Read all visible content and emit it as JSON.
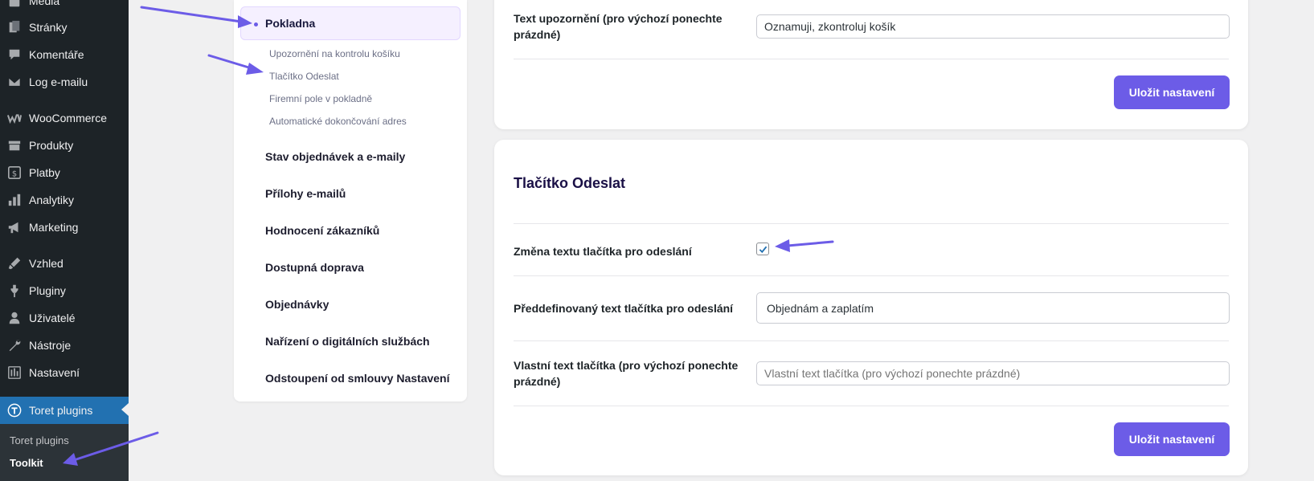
{
  "wp_menu": {
    "items": [
      {
        "label": "Média",
        "icon": "media-icon"
      },
      {
        "label": "Stránky",
        "icon": "pages-icon"
      },
      {
        "label": "Komentáře",
        "icon": "comments-icon"
      },
      {
        "label": "Log e-mailu",
        "icon": "email-icon"
      },
      {
        "label": "WooCommerce",
        "icon": "woocommerce-icon"
      },
      {
        "label": "Produkty",
        "icon": "products-icon"
      },
      {
        "label": "Platby",
        "icon": "payments-icon"
      },
      {
        "label": "Analytiky",
        "icon": "analytics-icon"
      },
      {
        "label": "Marketing",
        "icon": "marketing-icon"
      },
      {
        "label": "Vzhled",
        "icon": "appearance-icon"
      },
      {
        "label": "Pluginy",
        "icon": "plugins-icon"
      },
      {
        "label": "Uživatelé",
        "icon": "users-icon"
      },
      {
        "label": "Nástroje",
        "icon": "tools-icon"
      },
      {
        "label": "Nastavení",
        "icon": "settings-icon"
      },
      {
        "label": "Toret plugins",
        "icon": "toret-icon"
      }
    ],
    "submenu": [
      "Toret plugins",
      "Toolkit"
    ]
  },
  "settings_nav": {
    "current": "Pokladna",
    "subitems": [
      "Upozornění na kontrolu košíku",
      "Tlačítko Odeslat",
      "Firemní pole v pokladně",
      "Automatické dokončování adres"
    ],
    "items": [
      "Stav objednávek a e-maily",
      "Přílohy e-mailů",
      "Hodnocení zákazníků",
      "Dostupná doprava",
      "Objednávky",
      "Nařízení o digitálních službách",
      "Odstoupení od smlouvy Nastavení"
    ]
  },
  "card1": {
    "warning_label": "Text upozornění (pro výchozí ponechte prázdné)",
    "warning_value": "Oznamuji, zkontroluj košík",
    "save_label": "Uložit nastavení"
  },
  "card2": {
    "title": "Tlačítko Odeslat",
    "change_label": "Změna textu tlačítka pro odeslání",
    "change_checked": true,
    "predefined_label": "Předdefinovaný text tlačítka pro odeslání",
    "predefined_value": "Objednám a zaplatím",
    "custom_label": "Vlastní text tlačítka (pro výchozí ponechte prázdné)",
    "custom_placeholder": "Vlastní text tlačítka (pro výchozí ponechte prázdné)",
    "save_label": "Uložit nastavení"
  },
  "colors": {
    "accent": "#6c5ce7",
    "wp_sidebar": "#1d2327",
    "wp_active": "#2271b1",
    "annotation_arrow": "#6c5ce7"
  }
}
